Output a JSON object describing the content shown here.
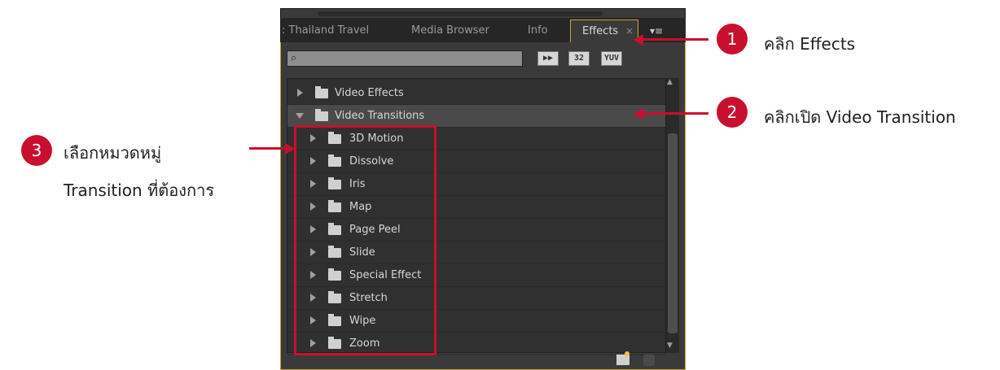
{
  "tabs": [
    {
      "label": ": Thailand Travel"
    },
    {
      "label": "Media Browser"
    },
    {
      "label": "Info"
    },
    {
      "label": "Effects"
    }
  ],
  "tab_close_glyph": "×",
  "tab_menu_glyph": "▾≡",
  "search": {
    "placeholder": "",
    "icon": "search-icon"
  },
  "badges": [
    "▶▶",
    "32",
    "YUV"
  ],
  "tree": {
    "top_items": [
      {
        "label": "Video Effects",
        "expanded": false
      },
      {
        "label": "Video Transitions",
        "expanded": true
      }
    ],
    "children": [
      {
        "label": "3D Motion"
      },
      {
        "label": "Dissolve"
      },
      {
        "label": "Iris"
      },
      {
        "label": "Map"
      },
      {
        "label": "Page Peel"
      },
      {
        "label": "Slide"
      },
      {
        "label": "Special Effect"
      },
      {
        "label": "Stretch"
      },
      {
        "label": "Wipe"
      },
      {
        "label": "Zoom"
      }
    ]
  },
  "annotations": [
    {
      "number": "1",
      "text": "คลิก Effects"
    },
    {
      "number": "2",
      "text": "คลิกเปิด Video Transition"
    },
    {
      "number": "3",
      "text_line1": "เลือกหมวดหมู่",
      "text_line2": "Transition ที่ต้องการ"
    }
  ],
  "colors": {
    "accent_red": "#c8102e",
    "tab_highlight": "#c9a13a",
    "panel_bg": "#3a3a3a"
  }
}
